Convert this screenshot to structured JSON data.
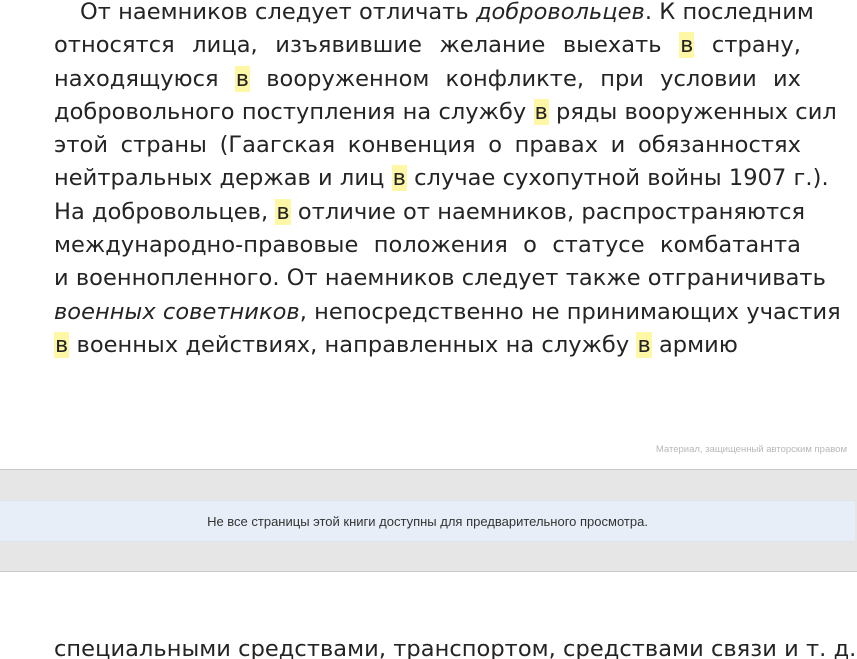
{
  "page_top": {
    "lines": [
      [
        {
          "t": "От наемников следует отличать "
        },
        {
          "t": "добровольцев",
          "i": true
        },
        {
          "t": ". К последним"
        }
      ],
      [
        {
          "t": "относятся лица, изъявившие желание выехать "
        },
        {
          "t": "в",
          "h": true
        },
        {
          "t": " страну,"
        }
      ],
      [
        {
          "t": "находящуюся "
        },
        {
          "t": "в",
          "h": true
        },
        {
          "t": " вооруженном конфликте, при условии их"
        }
      ],
      [
        {
          "t": "добровольного поступления на службу "
        },
        {
          "t": "в",
          "h": true
        },
        {
          "t": " ряды вооруженных сил"
        }
      ],
      [
        {
          "t": "этой страны (Гаагская конвенция о правах и обязанностях"
        }
      ],
      [
        {
          "t": "нейтральных держав и лиц "
        },
        {
          "t": "в",
          "h": true
        },
        {
          "t": " случае сухопутной войны 1907 г.)."
        }
      ],
      [
        {
          "t": "На добровольцев, "
        },
        {
          "t": "в",
          "h": true
        },
        {
          "t": " отличие от наемников, распространяются"
        }
      ],
      [
        {
          "t": "международно-правовые положения о статусе комбатанта"
        }
      ],
      [
        {
          "t": "и военнопленного. От наемников следует также отграничивать"
        }
      ],
      [
        {
          "t": "военных советников",
          "i": true
        },
        {
          "t": ", непосредственно не принимающих участия"
        }
      ],
      [
        {
          "t": "в",
          "h": true
        },
        {
          "t": " военных действиях, направленных на службу "
        },
        {
          "t": "в",
          "h": true
        },
        {
          "t": " армию"
        }
      ]
    ],
    "copyright_notice": "Материал, защищенный авторским правом"
  },
  "preview_notice": "Не все страницы этой книги доступны для предварительного просмотра.",
  "page_bottom": {
    "lines": [
      [
        {
          "t": "специальными средствами, транспортом, средствами связи и т. д."
        }
      ]
    ]
  },
  "colors": {
    "search_highlight": "#fdf7a6",
    "gap_band": "#e6e6e6",
    "notice_bar": "#e7eef8",
    "body_text": "#242424"
  }
}
